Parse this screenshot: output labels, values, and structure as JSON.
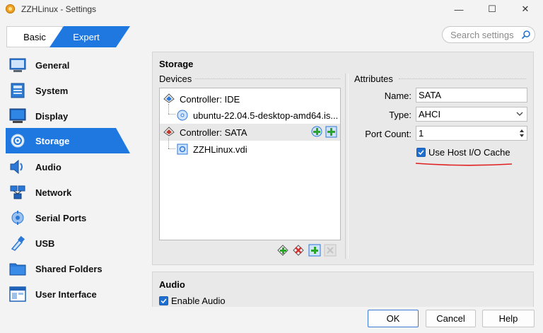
{
  "window": {
    "title": "ZZHLinux - Settings",
    "min": "—",
    "max": "☐",
    "close": "✕"
  },
  "mode": {
    "basic": "Basic",
    "expert": "Expert"
  },
  "search": {
    "placeholder": "Search settings"
  },
  "sidebar": {
    "items": [
      {
        "label": "General",
        "icon": "general-icon"
      },
      {
        "label": "System",
        "icon": "system-icon"
      },
      {
        "label": "Display",
        "icon": "display-icon"
      },
      {
        "label": "Storage",
        "icon": "storage-icon",
        "active": true
      },
      {
        "label": "Audio",
        "icon": "audio-icon"
      },
      {
        "label": "Network",
        "icon": "network-icon"
      },
      {
        "label": "Serial Ports",
        "icon": "serial-ports-icon"
      },
      {
        "label": "USB",
        "icon": "usb-icon"
      },
      {
        "label": "Shared Folders",
        "icon": "shared-folders-icon"
      },
      {
        "label": "User Interface",
        "icon": "user-interface-icon"
      }
    ]
  },
  "storage": {
    "title": "Storage",
    "devices_label": "Devices",
    "tree": [
      {
        "label": "Controller: IDE"
      },
      {
        "label": "ubuntu-22.04.5-desktop-amd64.is..."
      },
      {
        "label": "Controller: SATA"
      },
      {
        "label": "ZZHLinux.vdi"
      }
    ],
    "attributes": {
      "label": "Attributes",
      "name_label": "Name:",
      "name_value": "SATA",
      "type_label": "Type:",
      "type_value": "AHCI",
      "port_label": "Port Count:",
      "port_value": "1",
      "cache_label": "Use Host I/O Cache",
      "cache_checked": true
    }
  },
  "audio": {
    "title": "Audio",
    "enable_label": "Enable Audio",
    "enabled": true
  },
  "footer": {
    "ok": "OK",
    "cancel": "Cancel",
    "help": "Help"
  },
  "colors": {
    "accent": "#1e6fd0",
    "annotation": "#e02020"
  }
}
